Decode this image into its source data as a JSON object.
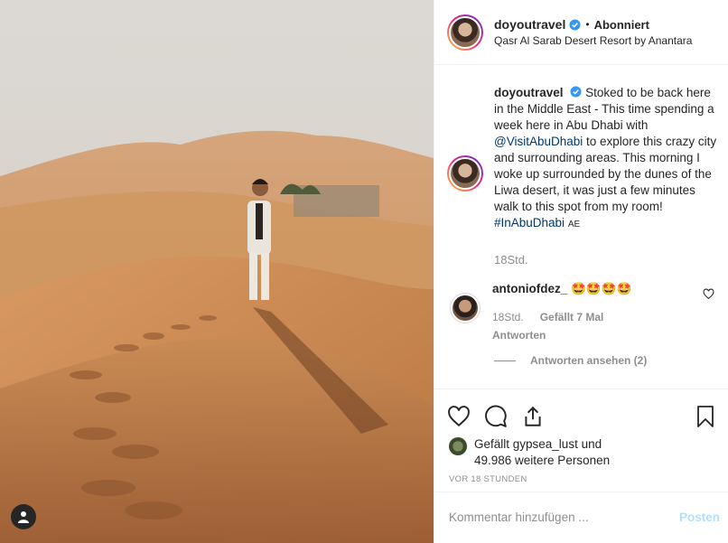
{
  "post": {
    "author": "doyoutravel",
    "follow_state": "Abonniert",
    "separator": "•",
    "location": "Qasr Al Sarab Desert Resort by Anantara"
  },
  "caption": {
    "username": "doyoutravel",
    "text_part1": "Stoked to be back here in the Middle East - This time spending a week here in Abu Dhabi with ",
    "mention": "@VisitAbuDhabi",
    "text_part2": " to explore this crazy city and surrounding areas. This morning I woke up surrounded by the dunes of the Liwa desert, it was just a few minutes walk to this spot from my room! ",
    "hashtag": "#InAbuDhabi",
    "flag": "AE",
    "time": "18Std."
  },
  "comment": {
    "username": "antoniofdez_",
    "emojis": "🤩🤩🤩🤩",
    "time": "18Std.",
    "likes": "Gefällt 7 Mal",
    "reply_label": "Antworten",
    "view_replies": "Antworten ansehen (2)"
  },
  "likes": {
    "line1": "Gefällt gypsea_lust und",
    "line2": "49.986 weitere Personen"
  },
  "timestamp": "VOR 18 STUNDEN",
  "comment_box": {
    "placeholder": "Kommentar hinzufügen ...",
    "post_label": "Posten"
  },
  "icons": [
    "heart-icon",
    "comment-icon",
    "share-icon",
    "bookmark-icon",
    "verified-badge-icon",
    "user-tag-icon"
  ],
  "colors": {
    "verified": "#3897f0",
    "link": "#00376b",
    "muted": "#8e8e8e",
    "post_button": "#b2dffc"
  }
}
